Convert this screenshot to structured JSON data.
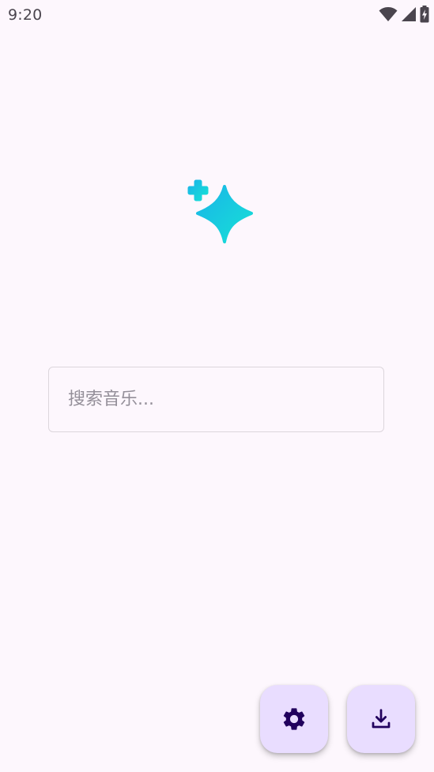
{
  "status_bar": {
    "time": "9:20",
    "icons": [
      "wifi-icon",
      "cellular-signal-icon",
      "battery-charging-icon"
    ]
  },
  "logo": {
    "icon": "sparkle-icon",
    "gradient": [
      "#1ab5e8",
      "#16e0d6"
    ]
  },
  "search": {
    "placeholder": "搜索音乐...",
    "value": ""
  },
  "actions": {
    "settings_icon": "gear-icon",
    "download_icon": "download-icon",
    "fab_color": "#e9ddff",
    "icon_color": "#21005d"
  },
  "colors": {
    "background": "#fdf7fd",
    "outline": "#dcd6dc"
  }
}
